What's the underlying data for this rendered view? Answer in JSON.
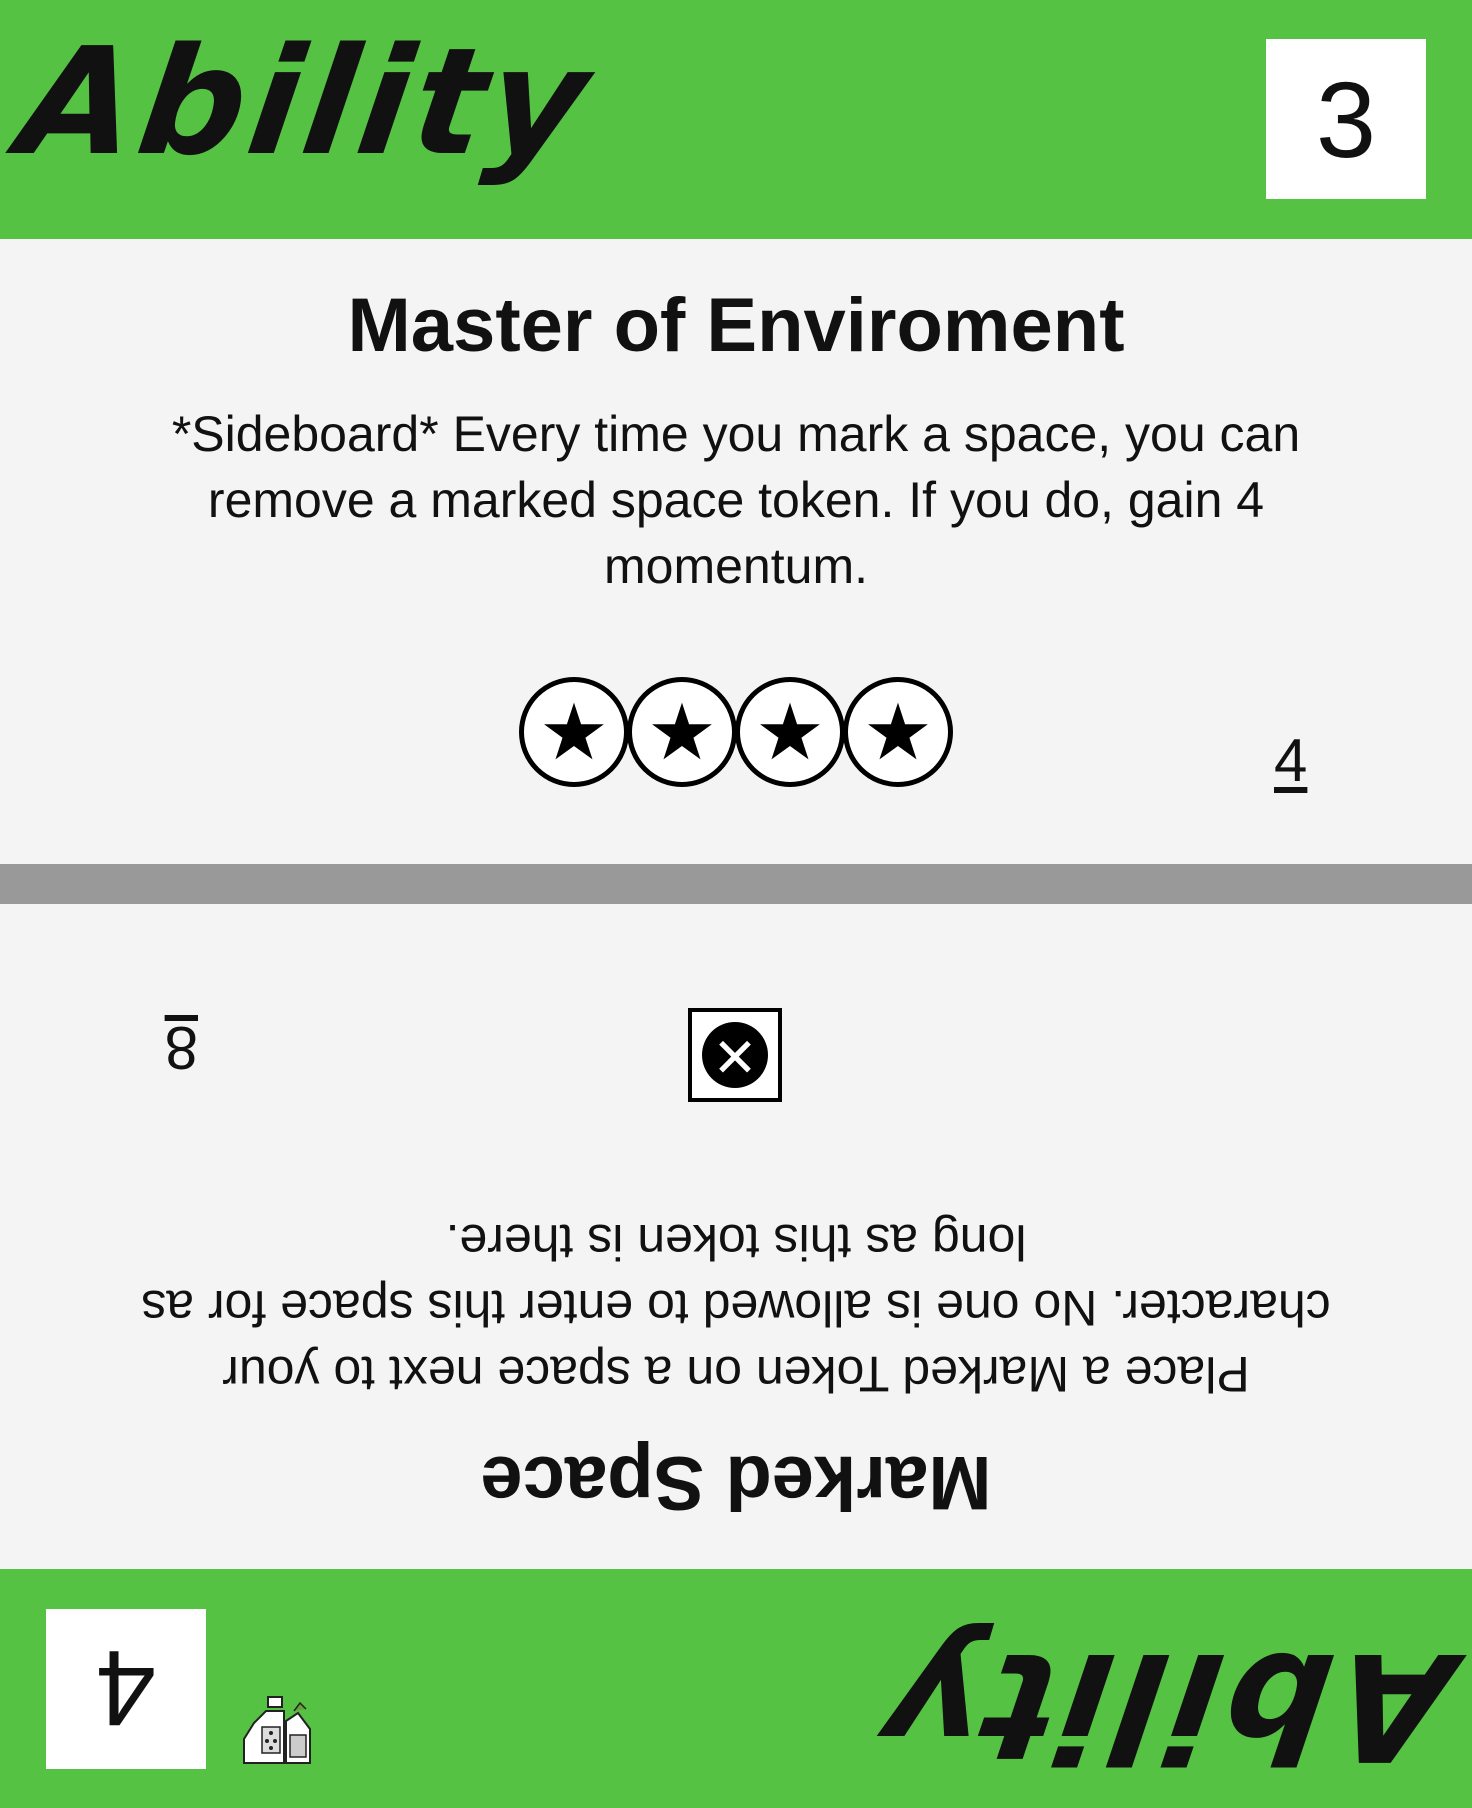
{
  "top": {
    "type_label": "Ability",
    "cost": "3",
    "title": "Master of Enviroment",
    "text": "*Sideboard* Every time you mark a space, you can remove a marked space token. If you do, gain 4 momentum.",
    "value": "4",
    "star_icon": "star-in-circle",
    "star_count": 4
  },
  "bottom": {
    "type_label": "Ability",
    "cost": "4",
    "title": "Marked Space",
    "text": "Place a Marked Token on a space next to your character. No one is allowed to enter this space for as long as this token is there.",
    "value": "8",
    "marked_icon": "x-circle-in-square",
    "set_icon": "potion-bottles"
  },
  "colors": {
    "band": "#55c243",
    "panel": "#f4f4f4",
    "divider": "#999999"
  }
}
